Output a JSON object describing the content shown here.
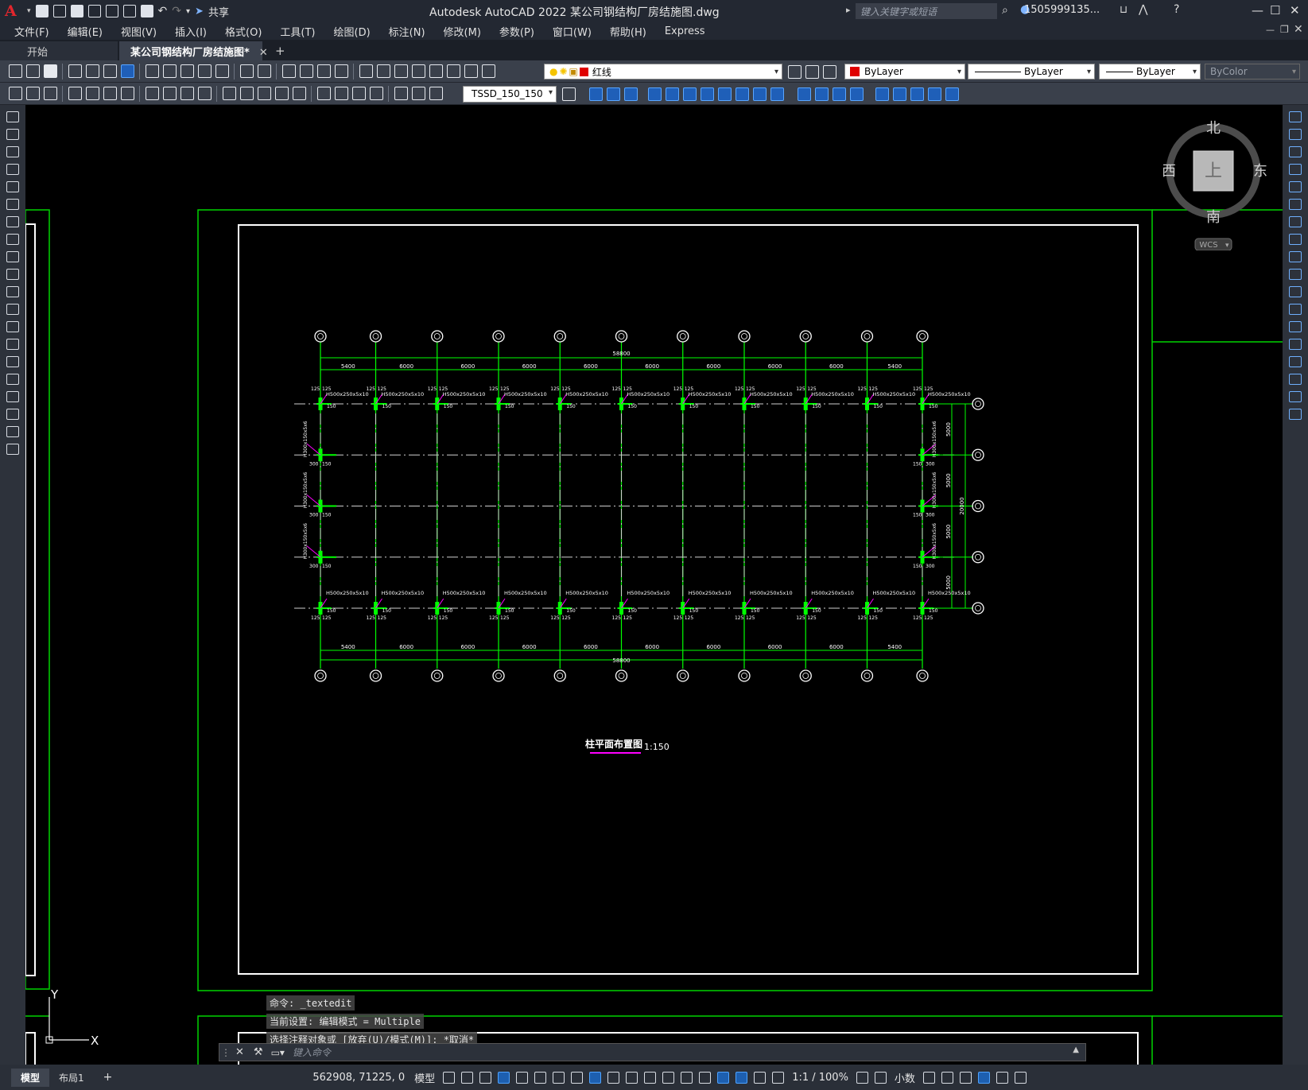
{
  "app": {
    "title": "Autodesk AutoCAD 2022    某公司钢结构厂房结施图.dwg",
    "logo": "A",
    "share": "共享",
    "search_placeholder": "键入关键字或短语",
    "user": "1505999135...",
    "accent": "#e3262d"
  },
  "menu": [
    "文件(F)",
    "编辑(E)",
    "视图(V)",
    "插入(I)",
    "格式(O)",
    "工具(T)",
    "绘图(D)",
    "标注(N)",
    "修改(M)",
    "参数(P)",
    "窗口(W)",
    "帮助(H)",
    "Express"
  ],
  "tabs": [
    {
      "label": "开始"
    },
    {
      "label": "某公司钢结构厂房结施图*",
      "close": "✕"
    },
    {
      "label": "+"
    }
  ],
  "toolbar": {
    "layer": "红线",
    "color": "ByLayer",
    "linetype": "ByLayer",
    "lineweight": "ByLayer",
    "plotstyle": "ByColor",
    "dimstyle": "TSSD_150_150",
    "red": "#e00000"
  },
  "compass": {
    "north": "北",
    "south": "南",
    "east": "东",
    "west": "西",
    "top": "上",
    "wcs": "WCS"
  },
  "drawing": {
    "title": "柱平面布置图",
    "scale": "1:150",
    "total_width": "58800",
    "total_depth": "20000",
    "bay_top": [
      "5400",
      "6000",
      "6000",
      "6000",
      "6000",
      "6000",
      "6000",
      "6000",
      "6000",
      "5400"
    ],
    "bay_side": [
      "5000",
      "5000",
      "5000",
      "5000"
    ],
    "column_label": "H500x250x5x10",
    "gable_label": "H300x150x5x6",
    "offset_top": "125",
    "offset_side": "300",
    "offset_150": "150",
    "green": "#00ff00",
    "magenta": "#ff00ff"
  },
  "ucs": {
    "x": "X",
    "y": "Y"
  },
  "command": {
    "history": [
      "命令: _textedit",
      "当前设置: 编辑模式 = Multiple",
      "选择注释对象或 [放弃(U)/模式(M)]: *取消*"
    ],
    "placeholder": "键入命令"
  },
  "status": {
    "model_tab": "模型",
    "layout_tab": "布局1",
    "add": "+",
    "coords": "562908, 71225, 0",
    "model": "模型",
    "scale": "1:1 / 100%",
    "units": "小数"
  }
}
